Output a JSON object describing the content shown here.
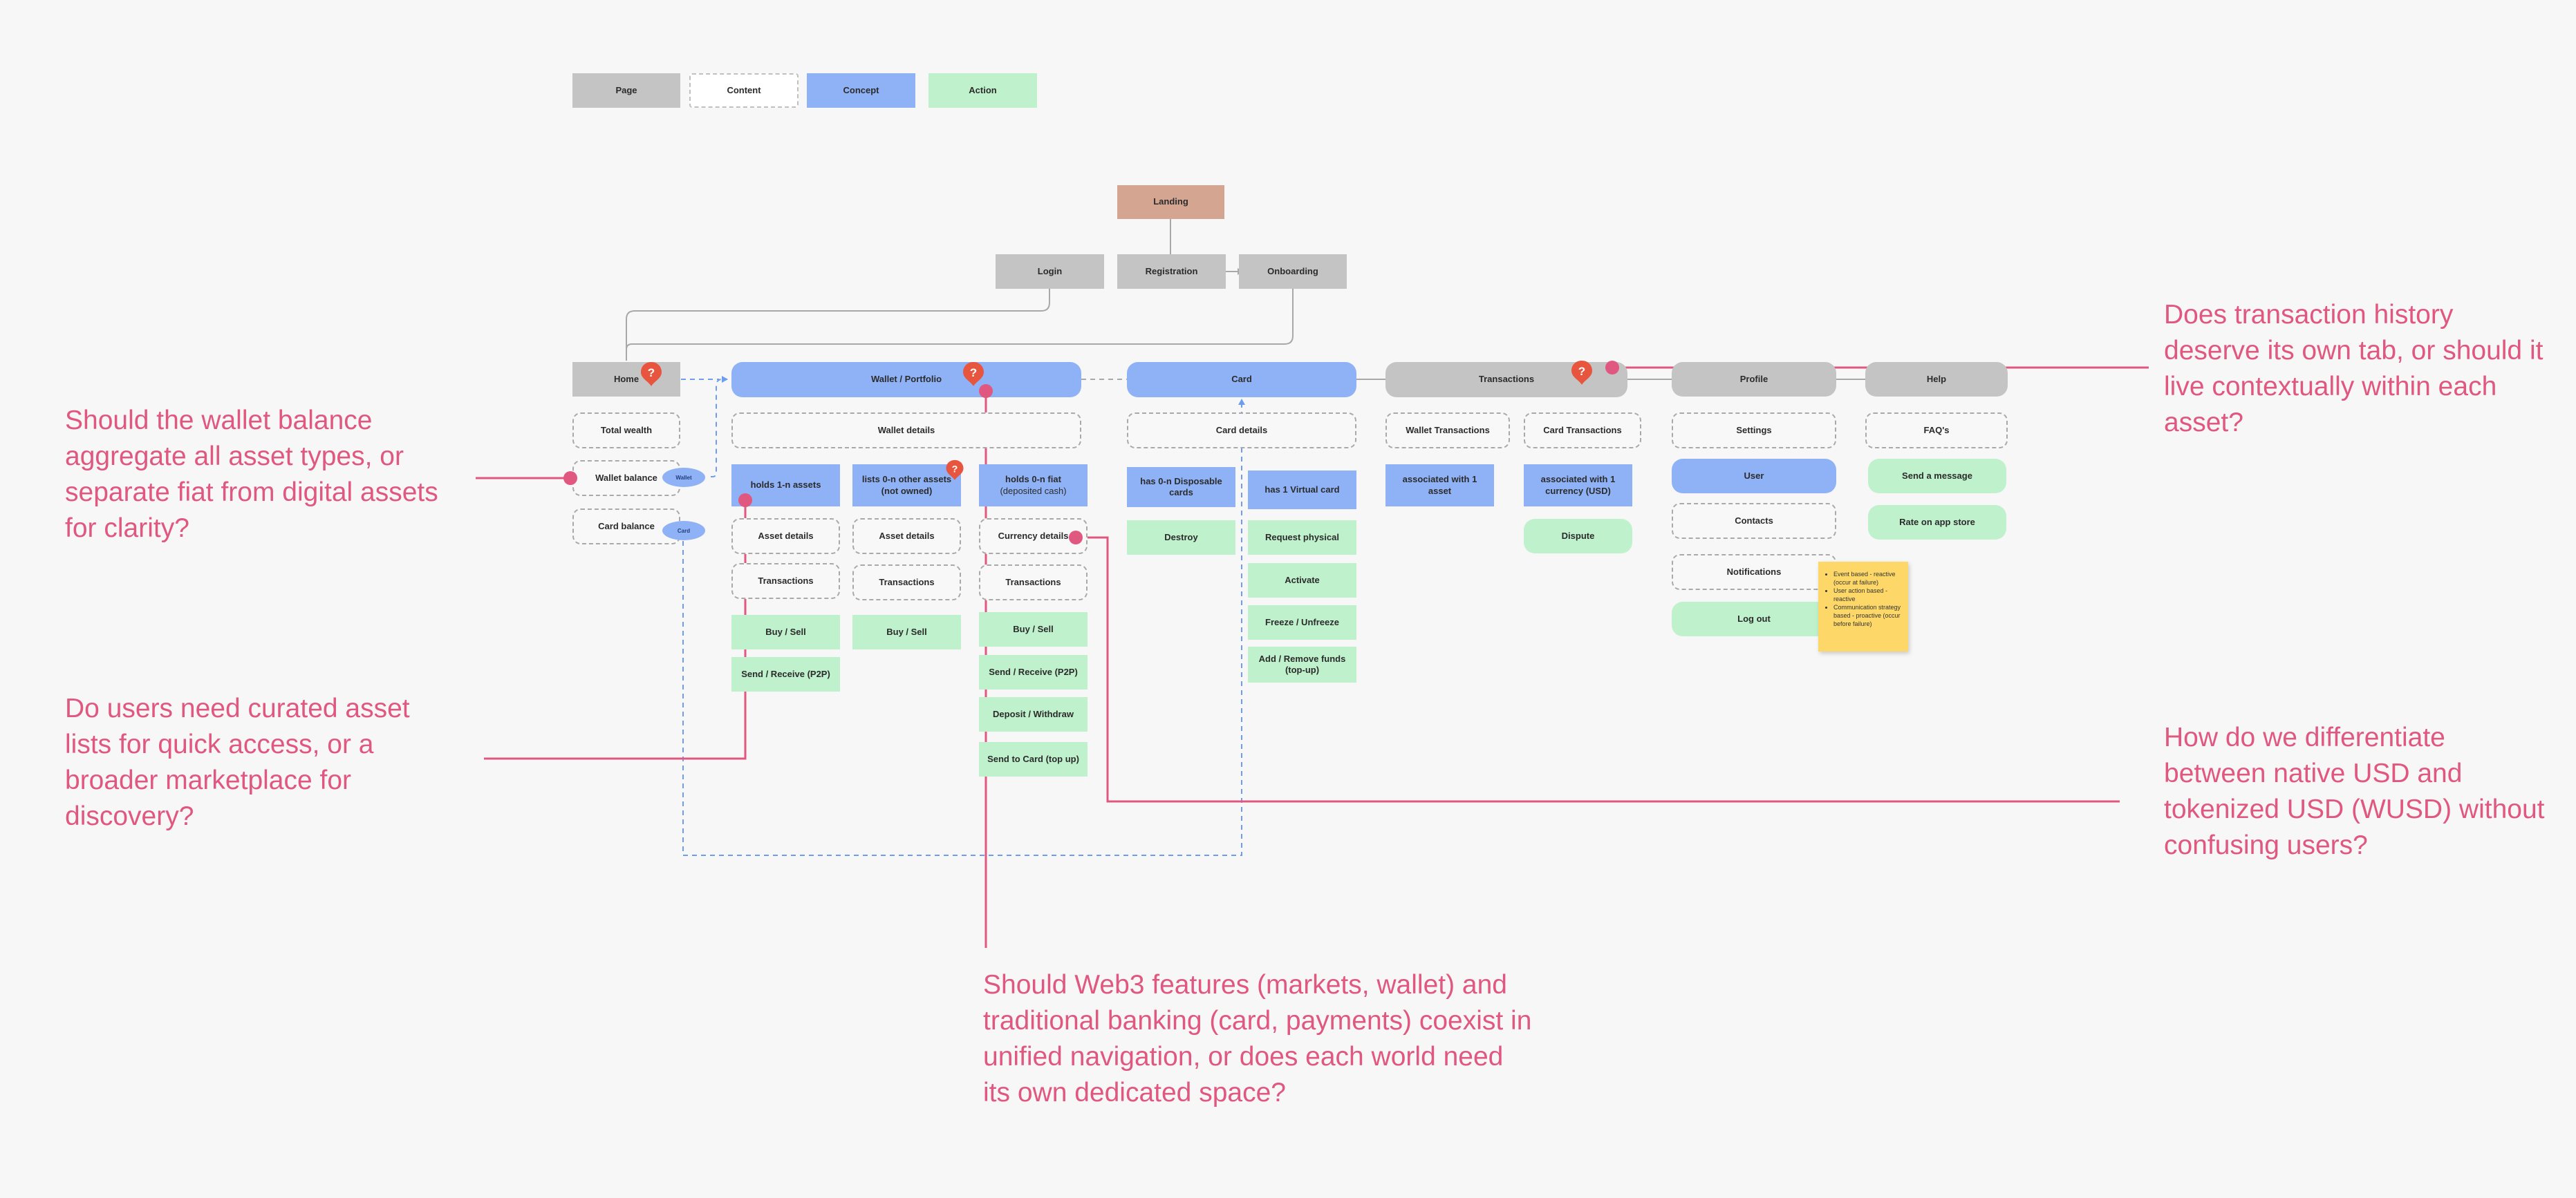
{
  "legend": {
    "page": "Page",
    "content": "Content",
    "concept": "Concept",
    "action": "Action"
  },
  "nodes": {
    "landing": "Landing",
    "login": "Login",
    "registration": "Registration",
    "onboarding": "Onboarding",
    "home": "Home",
    "total_wealth": "Total wealth",
    "wallet_balance": "Wallet balance",
    "card_balance": "Card balance",
    "wallet_portfolio": "Wallet / Portfolio",
    "wallet_details": "Wallet details",
    "holds_assets": "holds 1-n assets",
    "lists_other_assets": "lists 0-n other assets (not owned)",
    "holds_fiat_title": "holds 0-n fiat",
    "holds_fiat_sub": "(deposited cash)",
    "asset_details_1": "Asset details",
    "transactions_1": "Transactions",
    "buy_sell_1": "Buy / Sell",
    "send_receive_1": "Send / Receive (P2P)",
    "asset_details_2": "Asset details",
    "transactions_2": "Transactions",
    "buy_sell_2": "Buy / Sell",
    "currency_details": "Currency details",
    "transactions_3": "Transactions",
    "buy_sell_3": "Buy / Sell",
    "send_receive_3": "Send / Receive (P2P)",
    "deposit_withdraw": "Deposit / Withdraw",
    "send_to_card": "Send to Card (top up)",
    "card": "Card",
    "card_details": "Card details",
    "disposable_cards": "has 0-n Disposable cards",
    "destroy": "Destroy",
    "virtual_card": "has 1 Virtual card",
    "request_physical": "Request physical",
    "activate": "Activate",
    "freeze": "Freeze / Unfreeze",
    "add_remove_funds": "Add / Remove funds (top-up)",
    "transactions": "Transactions",
    "wallet_transactions": "Wallet Transactions",
    "associated_asset": "associated with 1 asset",
    "card_transactions": "Card Transactions",
    "associated_currency": "associated with 1 currency (USD)",
    "dispute": "Dispute",
    "profile": "Profile",
    "settings": "Settings",
    "user": "User",
    "contacts": "Contacts",
    "notifications": "Notifications",
    "log_out": "Log out",
    "help": "Help",
    "faqs": "FAQ's",
    "send_message": "Send a message",
    "rate_app": "Rate on app store"
  },
  "pills": {
    "wallet": "Wallet",
    "card": "Card"
  },
  "sticky_note": [
    "Event based - reactive (occur at failure)",
    "User action based - reactive",
    "Communication strategy based - proactive (occur before failure)"
  ],
  "questions": {
    "wallet_balance": "Should the wallet balance aggregate all asset types, or separate fiat from digital assets for clarity?",
    "curated_lists": "Do users need curated asset lists for quick access, or a broader marketplace for discovery?",
    "web3_navigation": "Should Web3 features (markets, wallet) and traditional banking (card, payments) coexist in unified navigation, or does each world need its own dedicated space?",
    "transaction_history": "Does transaction history deserve its own tab, or should it live contextually within each asset?",
    "usd_wusd": "How do we differentiate between native USD and tokenized USD (WUSD) without confusing users?"
  },
  "colors": {
    "page": "#c4c4c4",
    "concept": "#8fb2f6",
    "action": "#bff1cc",
    "landing": "#d4a591",
    "annotation": "#e0577f",
    "marker": "#e8553f",
    "sticky": "#fdd868",
    "connector_dashed": "#6e9df0"
  },
  "icons": {
    "question_marker": "question-pin-icon",
    "annotation_dot": "annotation-dot-icon"
  }
}
